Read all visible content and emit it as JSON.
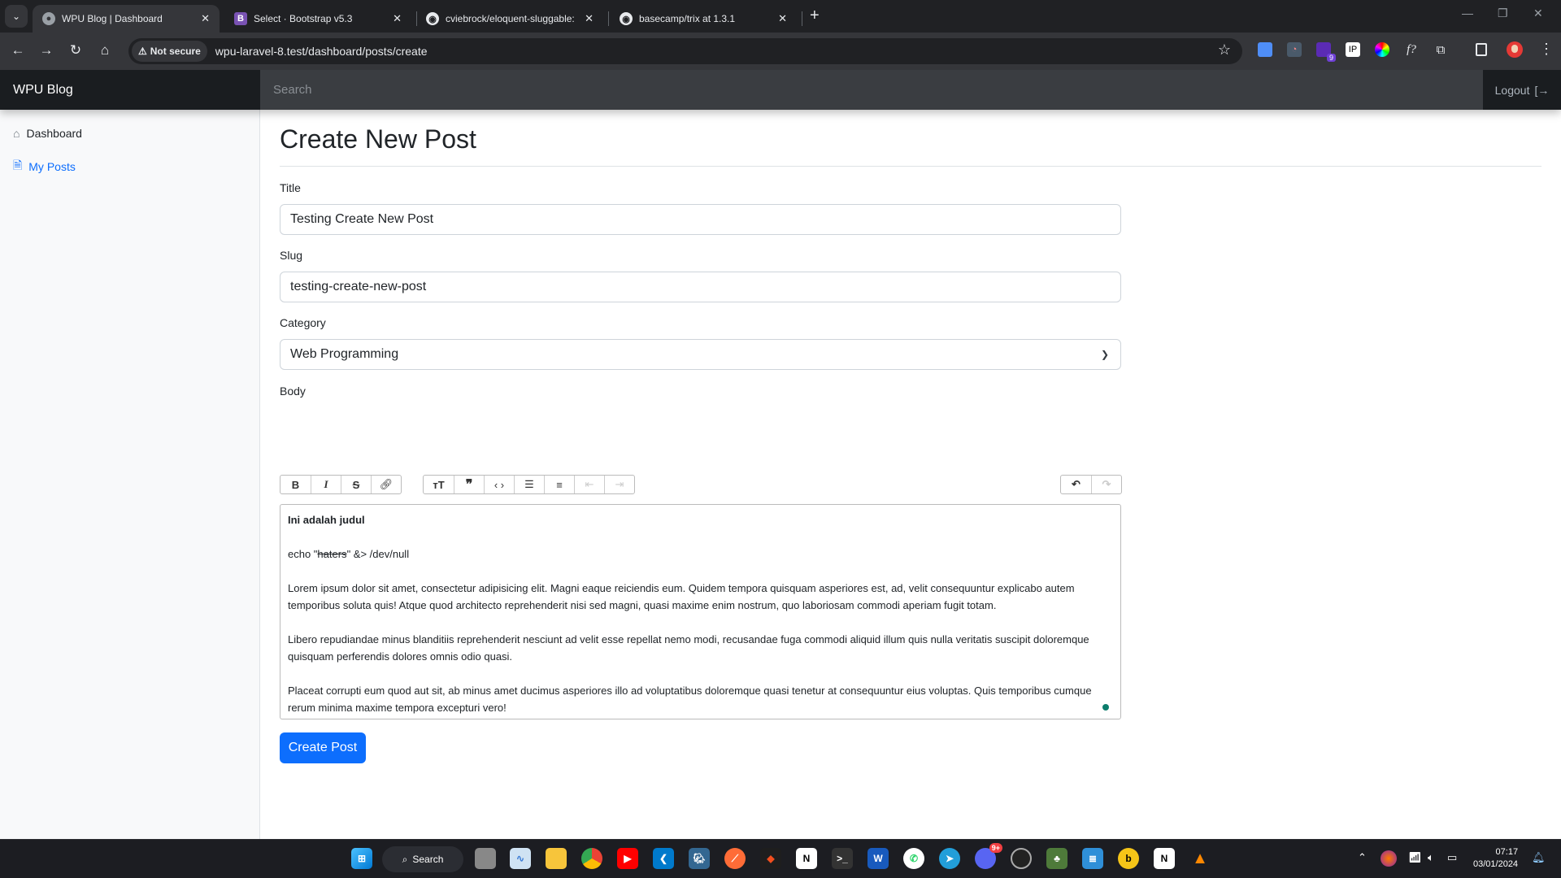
{
  "browser": {
    "tabs": [
      {
        "title": "WPU Blog | Dashboard",
        "favicon": "globe-icon",
        "active": true
      },
      {
        "title": "Select · Bootstrap v5.3",
        "favicon": "bootstrap-icon",
        "active": false
      },
      {
        "title": "cviebrock/eloquent-sluggable: E",
        "favicon": "github-icon",
        "active": false
      },
      {
        "title": "basecamp/trix at 1.3.1",
        "favicon": "github-icon",
        "active": false
      }
    ],
    "security_label": "Not secure",
    "url": "wpu-laravel-8.test/dashboard/posts/create",
    "extension_badge": "9"
  },
  "navbar": {
    "brand": "WPU Blog",
    "search_placeholder": "Search",
    "logout_label": "Logout"
  },
  "sidebar": {
    "items": [
      {
        "label": "Dashboard",
        "icon": "house-icon",
        "active": false
      },
      {
        "label": "My Posts",
        "icon": "file-text-icon",
        "active": true
      }
    ]
  },
  "main": {
    "title": "Create New Post",
    "form": {
      "title_label": "Title",
      "title_value": "Testing Create New Post",
      "slug_label": "Slug",
      "slug_value": "testing-create-new-post",
      "category_label": "Category",
      "category_value": "Web Programming",
      "body_label": "Body",
      "submit_label": "Create Post"
    },
    "editor": {
      "toolbar": {
        "text_tools": [
          "bold",
          "italic",
          "strike",
          "link"
        ],
        "block_tools": [
          "heading",
          "quote",
          "code",
          "bullet-list",
          "number-list",
          "decrease-indent",
          "increase-indent"
        ],
        "history_tools": [
          "undo",
          "redo"
        ]
      },
      "heading": "Ini adalah judul",
      "code_prefix": "echo \"",
      "code_struck": "haters",
      "code_suffix": "\" &> /dev/null",
      "paragraphs": [
        "Lorem ipsum dolor sit amet, consectetur adipisicing elit. Magni eaque reiciendis eum. Quidem tempora quisquam asperiores est, ad, velit consequuntur explicabo autem temporibus soluta quis! Atque quod architecto reprehenderit nisi sed magni, quasi maxime enim nostrum, quo laboriosam commodi aperiam fugit totam.",
        "Libero repudiandae minus blanditiis reprehenderit nesciunt ad velit esse repellat nemo modi, recusandae fuga commodi aliquid illum quis nulla veritatis suscipit doloremque quisquam perferendis dolores omnis odio quasi.",
        "Placeat corrupti eum quod aut sit, ab minus amet ducimus asperiores illo ad voluptatibus doloremque quasi tenetur at consequuntur eius voluptas. Quis temporibus cumque rerum minima maxime tempora excepturi vero!"
      ]
    }
  },
  "taskbar": {
    "search_label": "Search",
    "discord_badge": "9+",
    "time": "07:17",
    "date": "03/01/2024"
  },
  "colors": {
    "primary": "#0d6efd",
    "navbar": "#212529",
    "sidebar_bg": "#f8f9fa"
  }
}
